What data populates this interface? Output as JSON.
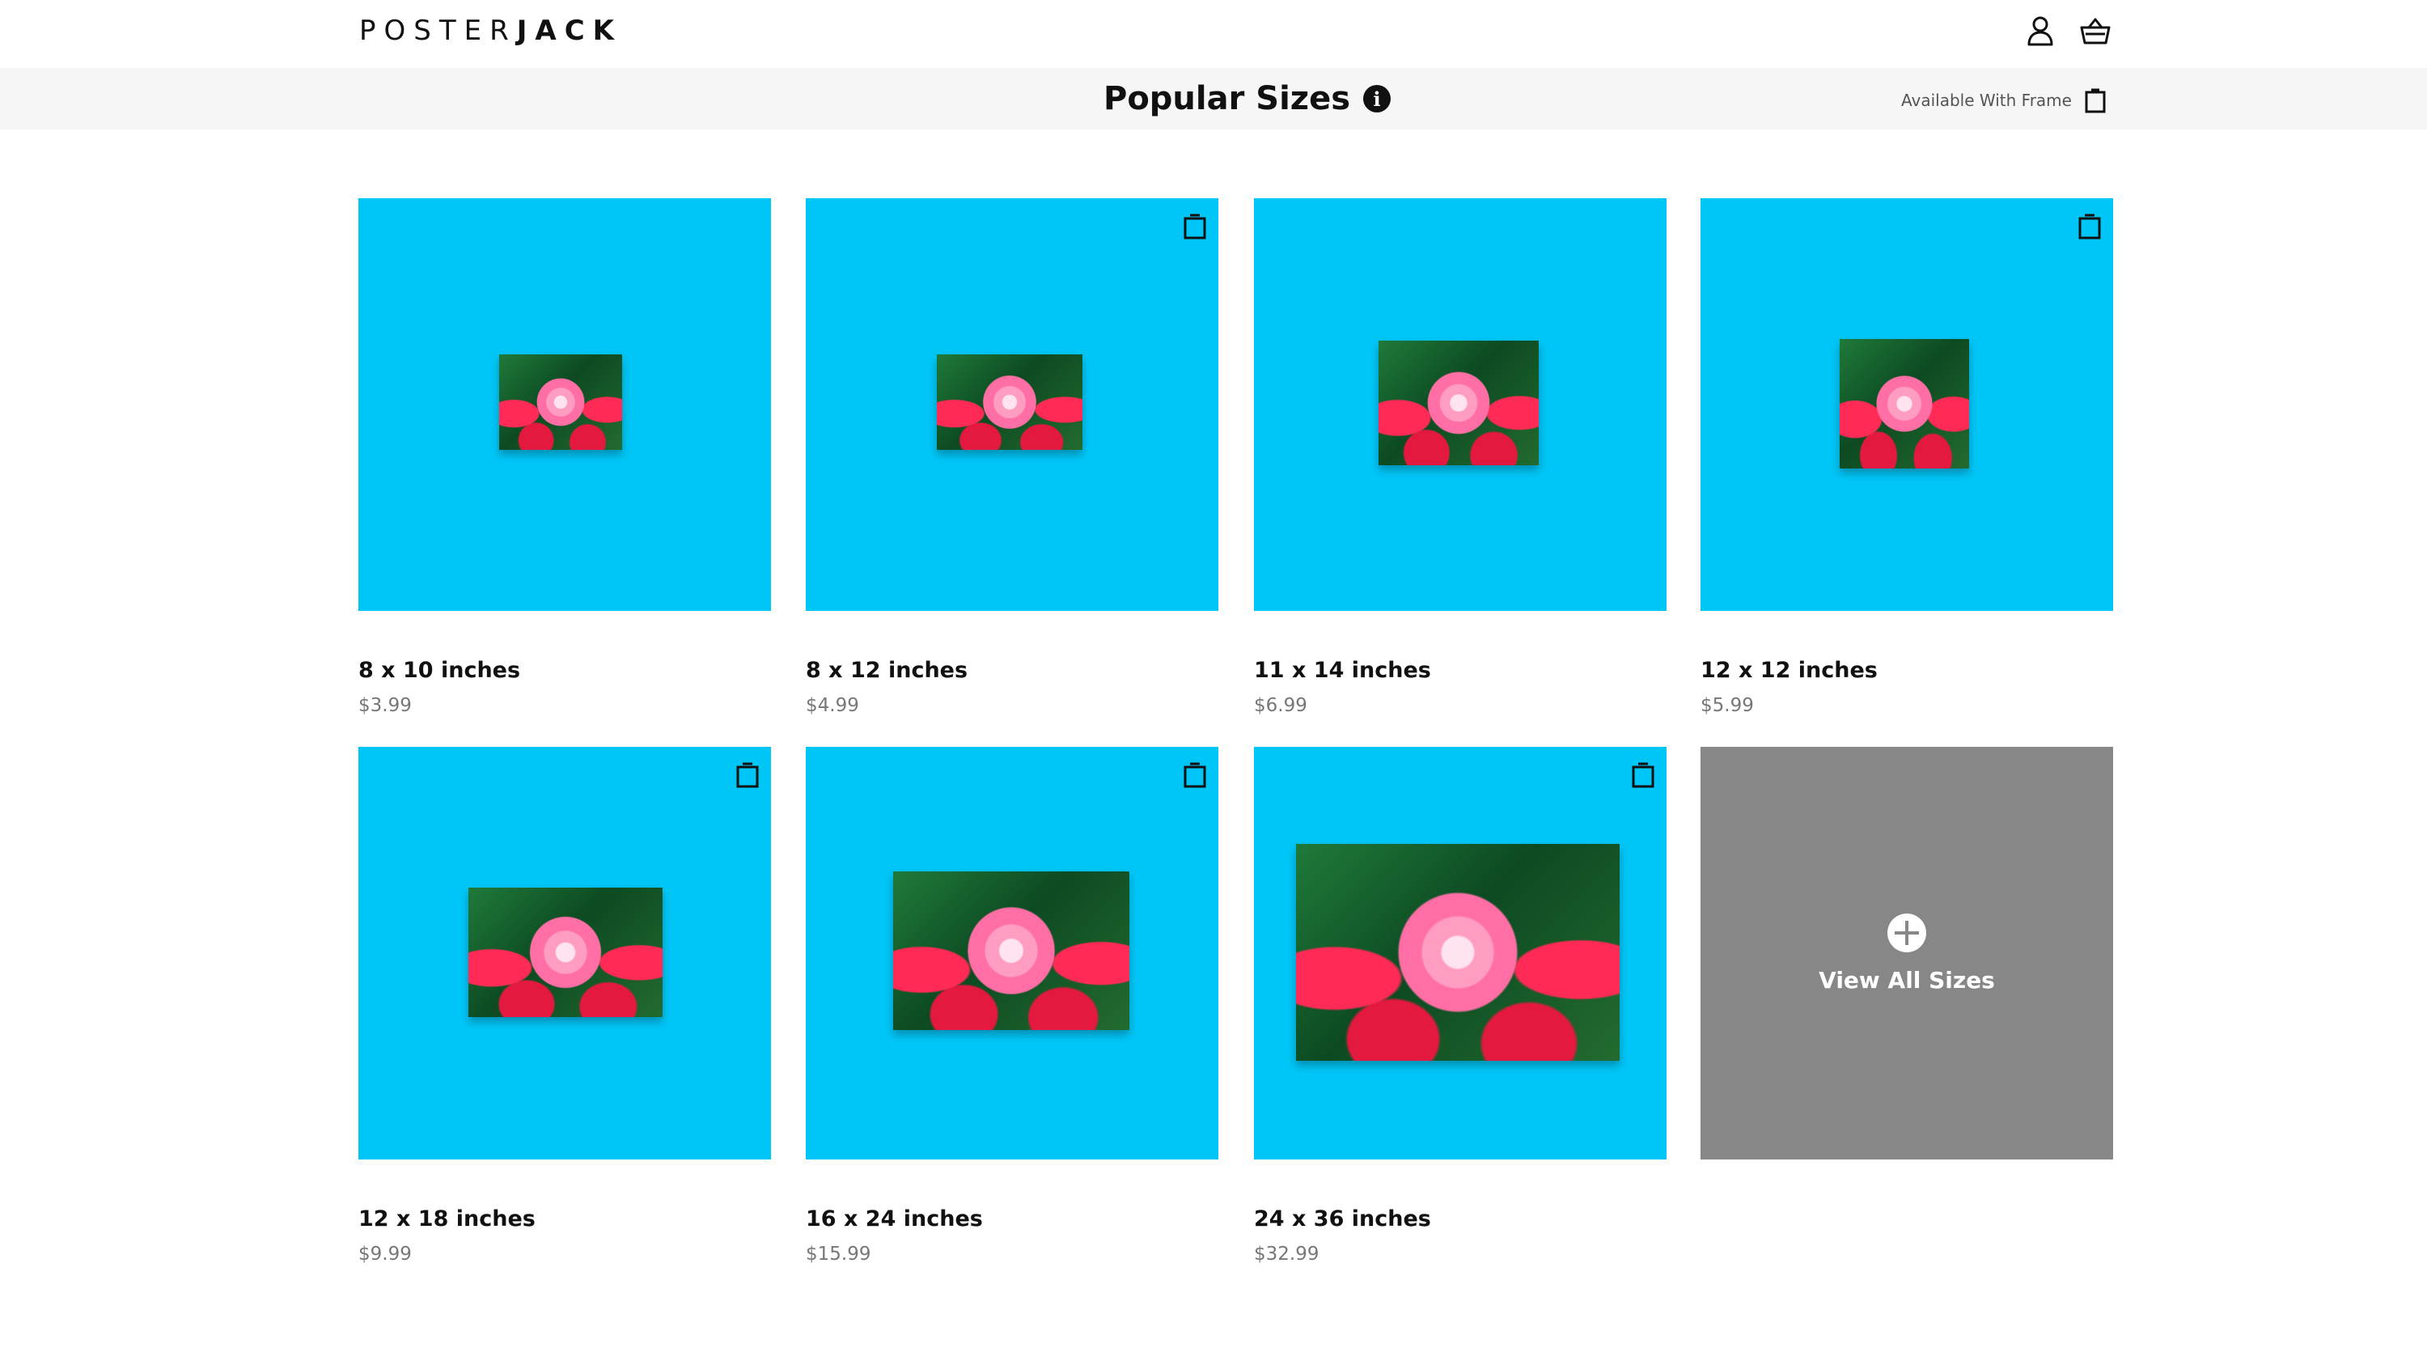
{
  "header": {
    "logo_left": "POSTER",
    "logo_right": "JACK",
    "icons": [
      "user-icon",
      "basket-icon"
    ]
  },
  "title_bar": {
    "title": "Popular Sizes",
    "info_glyph": "i",
    "legend_label": "Available With Frame",
    "legend_icon": "frame-icon"
  },
  "colors": {
    "tile_background": "#00c6f7",
    "view_all_background": "#878787",
    "title_bar_background": "#f6f6f6"
  },
  "sizes": [
    {
      "label": "8 x 10 inches",
      "price": "$3.99",
      "frame_available": false
    },
    {
      "label": "8 x 12 inches",
      "price": "$4.99",
      "frame_available": true
    },
    {
      "label": "11 x 14 inches",
      "price": "$6.99",
      "frame_available": false
    },
    {
      "label": "12 x 12 inches",
      "price": "$5.99",
      "frame_available": true
    },
    {
      "label": "12 x 18 inches",
      "price": "$9.99",
      "frame_available": true
    },
    {
      "label": "16 x 24 inches",
      "price": "$15.99",
      "frame_available": true
    },
    {
      "label": "24 x 36 inches",
      "price": "$32.99",
      "frame_available": true
    }
  ],
  "view_all": {
    "label": "View All Sizes",
    "icon": "plus-circle-icon"
  }
}
